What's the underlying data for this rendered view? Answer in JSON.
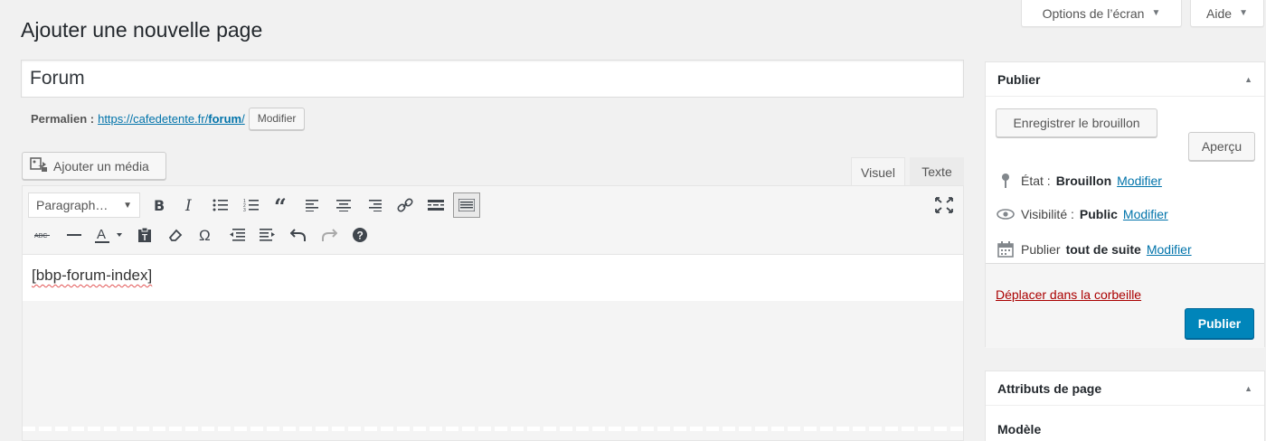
{
  "screen_meta": {
    "options_label": "Options de l’écran",
    "help_label": "Aide"
  },
  "page_title": "Ajouter une nouvelle page",
  "title_field": {
    "value": "Forum"
  },
  "permalink": {
    "label": "Permalien :",
    "base": "https://cafedetente.fr/",
    "slug": "forum",
    "suffix": "/",
    "edit_label": "Modifier"
  },
  "media": {
    "add_label": "Ajouter un média"
  },
  "editor_tabs": {
    "visual": "Visuel",
    "text": "Texte"
  },
  "toolbar": {
    "format_select": "Paragraph…"
  },
  "content": {
    "text": "[bbp-forum-index]"
  },
  "publish_box": {
    "title": "Publier",
    "save_draft": "Enregistrer le brouillon",
    "preview": "Aperçu",
    "status": {
      "label": "État :",
      "value": "Brouillon",
      "edit": "Modifier"
    },
    "visibility": {
      "label": "Visibilité :",
      "value": "Public",
      "edit": "Modifier"
    },
    "schedule": {
      "label": "Publier",
      "value": "tout de suite",
      "edit": "Modifier"
    },
    "trash": "Déplacer dans la corbeille",
    "publish": "Publier"
  },
  "attributes_box": {
    "title": "Attributs de page",
    "template_label": "Modèle"
  },
  "colors": {
    "link": "#0073aa",
    "primary": "#0085ba",
    "trash": "#aa0000"
  }
}
